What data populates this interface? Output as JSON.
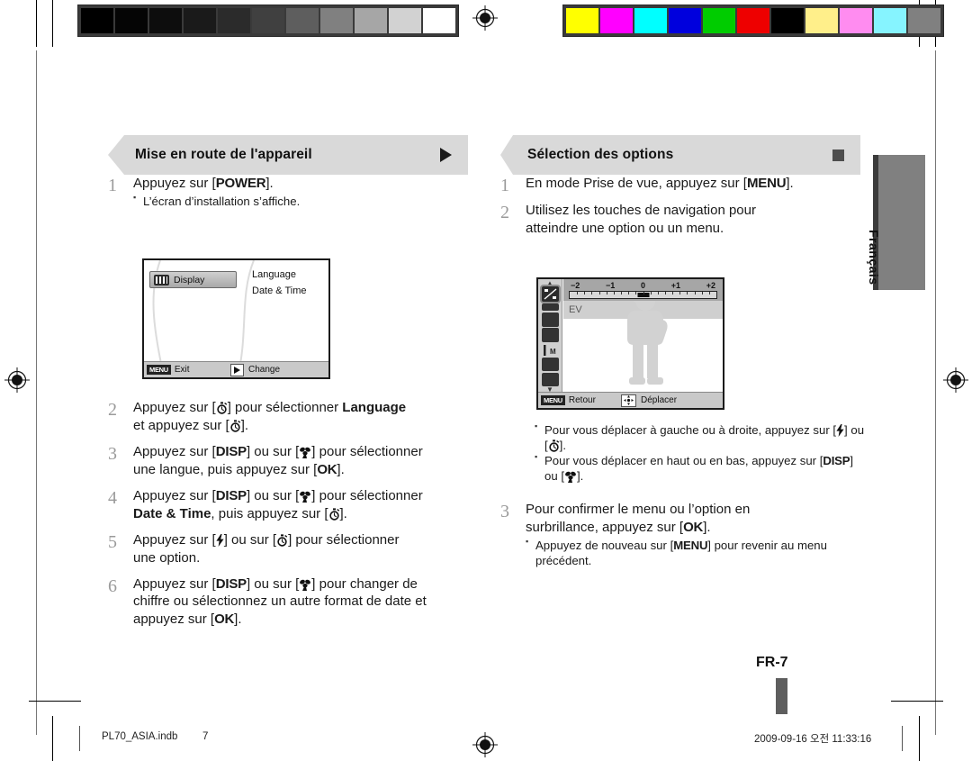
{
  "document": {
    "language_tab": "Français",
    "page_label": "FR-7",
    "file_name": "PL70_ASIA.indb",
    "file_page": "7",
    "file_date": "2009-09-16   오전 11:33:16"
  },
  "print_marks": {
    "gray_strip": [
      "#000000",
      "#050505",
      "#0d0d0d",
      "#1a1a1a",
      "#2b2b2b",
      "#404040",
      "#5e5e5e",
      "#808080",
      "#a6a6a6",
      "#d2d2d2",
      "#ffffff"
    ],
    "color_strip": [
      "#ffff00",
      "#ff00ff",
      "#00ffff",
      "#0000dd",
      "#00cc00",
      "#ee0000",
      "#000000",
      "#ffef8a",
      "#ff8cf0",
      "#86f4ff",
      "#808080"
    ],
    "registration_icon": "registration-target-icon"
  },
  "left_column": {
    "banner": {
      "title": "Mise en route de l'appareil",
      "marker_icon": "triangle-right-icon"
    },
    "steps": [
      {
        "number": "1",
        "lines": [
          "Appuyez sur [POWER]."
        ],
        "bullets": [
          "L’écran d’installation s’affiche."
        ]
      },
      {
        "number": "2",
        "lines": [
          "Appuyez sur [⏱] pour sélectionner Language",
          "et appuyez sur [⏱]."
        ],
        "bullets": []
      },
      {
        "number": "3",
        "lines": [
          "Appuyez sur [DISP] ou sur [❀] pour sélectionner",
          "une langue, puis appuyez sur [OK]."
        ],
        "bullets": []
      },
      {
        "number": "4",
        "lines": [
          "Appuyez sur [DISP] ou sur [❀] pour sélectionner",
          "Date & Time, puis appuyez sur [⏱]."
        ],
        "bullets": []
      },
      {
        "number": "5",
        "lines": [
          "Appuyez sur [⚡] ou sur [⏱] pour sélectionner",
          "une option."
        ],
        "bullets": []
      },
      {
        "number": "6",
        "lines": [
          "Appuyez sur [DISP] ou sur [❀] pour changer de",
          "chiffre ou sélectionnez un autre format de date et",
          "appuyez sur [OK]."
        ],
        "bullets": []
      }
    ],
    "lcd_setup": {
      "highlighted_item": "Display",
      "highlight_icon": "display-icon",
      "right_items": [
        "Language",
        "Date & Time"
      ],
      "bottom_bar": {
        "menu_chip": "MENU",
        "left_label": "Exit",
        "mid_icon": "triangle-right-icon",
        "mid_label": "Change"
      }
    }
  },
  "right_column": {
    "banner": {
      "title": "Sélection des options",
      "marker_icon": "square-icon"
    },
    "steps": [
      {
        "number": "1",
        "lines": [
          "En mode Prise de vue, appuyez sur [MENU]."
        ],
        "bullets": []
      },
      {
        "number": "2",
        "lines": [
          "Utilisez les touches de navigation pour",
          "atteindre une option ou un menu."
        ],
        "bullets": []
      },
      {
        "number": "3",
        "lines": [
          "Pour confirmer le menu ou l’option en",
          "surbrillance, appuyez sur [OK]."
        ],
        "bullets": [
          "Appuyez de nouveau sur [MENU] pour revenir au menu précédent."
        ]
      }
    ],
    "screen_bullets": [
      "Pour vous déplacer à gauche ou à droite, appuyez sur [⚡] ou [⏱].",
      "Pour vous déplacer en haut ou en bas, appuyez sur [DISP] ou [❀]."
    ],
    "lcd_menu": {
      "ev_ticks": [
        "−2",
        "−1",
        "0",
        "+1",
        "+2"
      ],
      "ev_value": "0",
      "option_label": "EV",
      "side_icons": [
        "exposure-compensation-icon",
        "white-balance-icon",
        "iso-icon",
        "face-detection-off-icon",
        "focus-area-icon",
        "image-quality-icon",
        "voice-memo-off-icon"
      ],
      "selected_side_icon_index": 0,
      "bottom_bar": {
        "menu_chip": "MENU",
        "left_label": "Retour",
        "mid_icon": "four-way-navigation-icon",
        "mid_label": "Déplacer"
      }
    }
  }
}
